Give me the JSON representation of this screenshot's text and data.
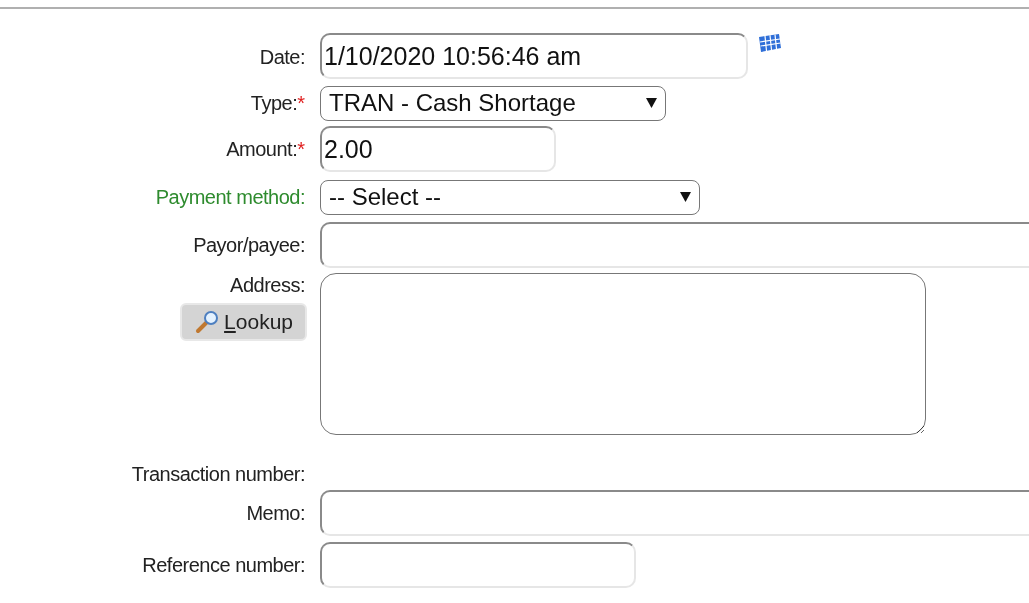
{
  "form": {
    "fields": [
      {
        "label": "Date:",
        "kind": "text",
        "value": "1/10/2020 10:56:46 am",
        "calendar_picker": true
      },
      {
        "label": "Type:",
        "required_mark": "*",
        "kind": "select",
        "value": "TRAN - Cash Shortage"
      },
      {
        "label": "Amount:",
        "required_mark": "*",
        "kind": "text",
        "value": "2.00"
      },
      {
        "label": "Payment method:",
        "color": "#2e8b2e",
        "kind": "select",
        "value": "-- Select --"
      },
      {
        "label": "Payor/payee:",
        "kind": "text"
      },
      {
        "label": "Address:",
        "kind": "textarea",
        "button": {
          "label": "Lookup",
          "underline_first": true
        }
      },
      {
        "label": "Transaction number:",
        "kind": "none"
      },
      {
        "label": "Memo:",
        "kind": "text"
      },
      {
        "label": "Reference number:",
        "kind": "text"
      }
    ]
  }
}
